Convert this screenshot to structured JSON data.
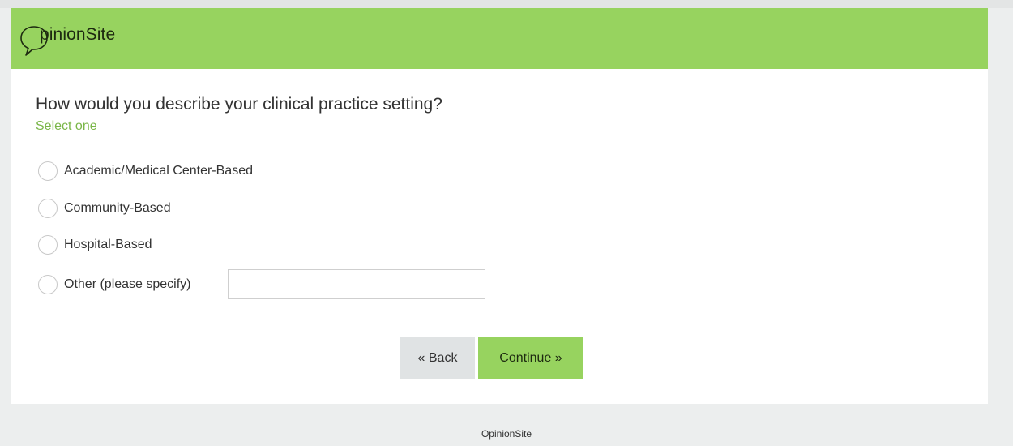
{
  "header": {
    "logo_text": "pinionSite",
    "brand_color": "#97d35f"
  },
  "question": {
    "text": "How would you describe your clinical practice setting?",
    "hint": "Select one",
    "hint_color": "#7ab648"
  },
  "options": [
    {
      "label": "Academic/Medical Center-Based",
      "selected": false
    },
    {
      "label": "Community-Based",
      "selected": false
    },
    {
      "label": "Hospital-Based",
      "selected": false
    },
    {
      "label": "Other (please specify)",
      "selected": false
    }
  ],
  "other_input": {
    "value": "",
    "placeholder": ""
  },
  "buttons": {
    "back_label": "« Back",
    "continue_label": "Continue »"
  },
  "footer": {
    "text": "OpinionSite"
  }
}
